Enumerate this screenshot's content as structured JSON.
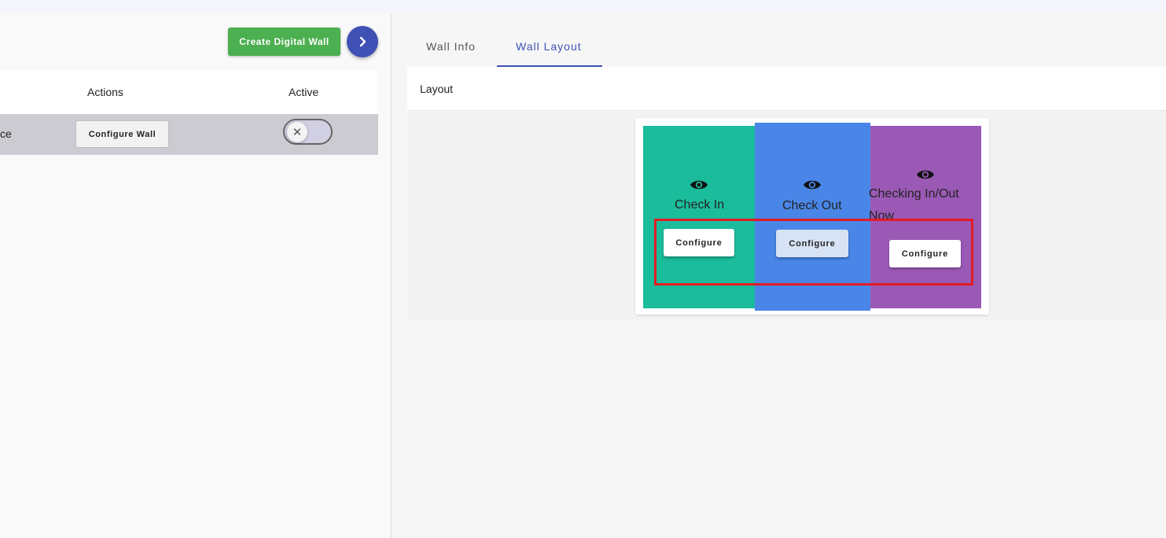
{
  "left_panel": {
    "create_button": "Create Digital Wall",
    "table": {
      "headers": {
        "actions": "Actions",
        "active": "Active"
      },
      "row": {
        "name_fragment": "ce",
        "configure_button": "Configure Wall",
        "active": false
      }
    }
  },
  "right_panel": {
    "tabs": [
      {
        "label": "Wall Info",
        "selected": false
      },
      {
        "label": "Wall Layout",
        "selected": true
      }
    ],
    "layout": {
      "title": "Layout",
      "panels": [
        {
          "label": "Check In",
          "color": "#1abc9c",
          "button": "Configure",
          "icon": "eye-icon"
        },
        {
          "label": "Check Out",
          "color": "#4a86e8",
          "button": "Configure",
          "icon": "eye-icon"
        },
        {
          "label": "Checking In/Out Now",
          "color": "#9b59b6",
          "button": "Configure",
          "icon": "eye-icon"
        }
      ],
      "highlight_color": "#e21b23"
    }
  },
  "colors": {
    "accent": "#3f51b5",
    "success": "#4caf50"
  }
}
